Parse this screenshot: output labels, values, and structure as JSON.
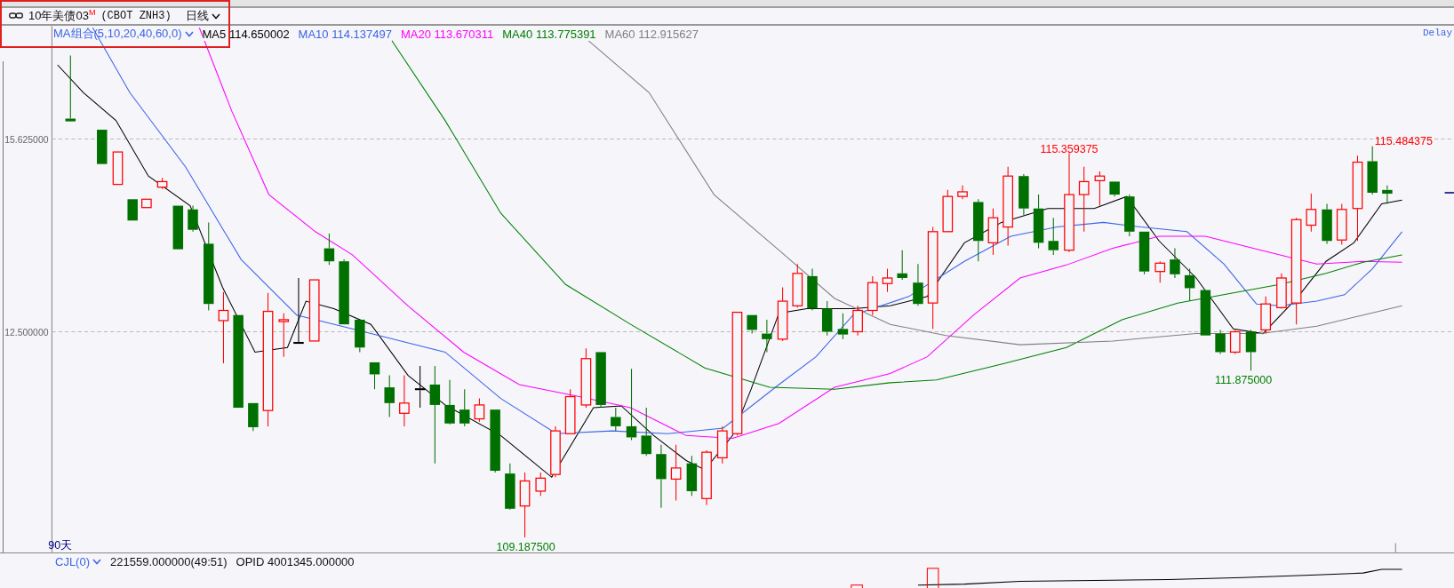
{
  "header": {
    "title": "10年美债03$^{M}$",
    "contract": "(CBOT ZNH3)",
    "period": "日线"
  },
  "legend": {
    "group": "MA组合(5,10,20,40,60,0)",
    "items": [
      {
        "name": "MA5",
        "value": "114.650002",
        "color": "#000000"
      },
      {
        "name": "MA10",
        "value": "114.137497",
        "color": "#3c64e6"
      },
      {
        "name": "MA20",
        "value": "113.670311",
        "color": "#ff00ff"
      },
      {
        "name": "MA40",
        "value": "113.775391",
        "color": "#008000"
      },
      {
        "name": "MA60",
        "value": "112.915627",
        "color": "#808080"
      }
    ]
  },
  "delay_label": "Delay",
  "chart": {
    "y_axis_labels": [
      "15.625000",
      "12.500000"
    ],
    "annotations": [
      {
        "text": "115.359375",
        "kind": "high"
      },
      {
        "text": "115.484375",
        "kind": "high"
      },
      {
        "text": "111.875000",
        "kind": "low"
      },
      {
        "text": "109.187500",
        "kind": "low"
      }
    ],
    "range_label": "90天"
  },
  "volume_panel": {
    "indicator": "CJL(0)",
    "reading": "221559.000000(49:51)",
    "opid": "OPID 4001345.000000"
  }
}
